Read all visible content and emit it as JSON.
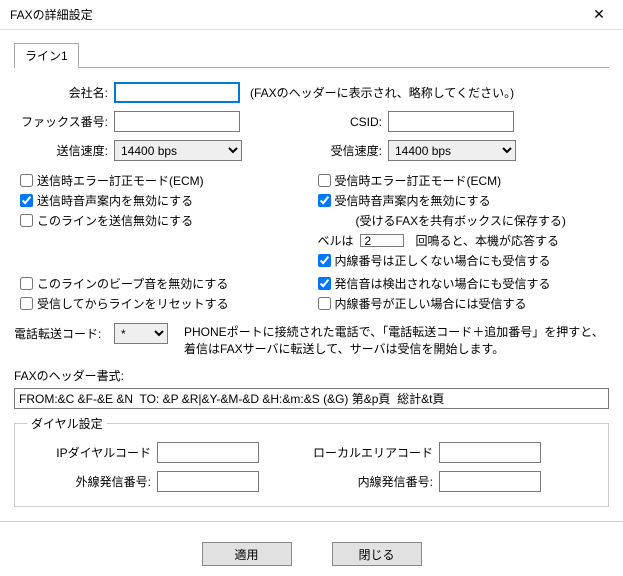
{
  "window": {
    "title": "FAXの詳細設定",
    "close_label": "✕"
  },
  "tabs": {
    "line1": "ライン1"
  },
  "labels": {
    "company": "会社名:",
    "company_hint": "(FAXのヘッダーに表示され、略称してください。)",
    "fax_number": "ファックス番号:",
    "csid": "CSID:",
    "send_speed": "送信速度:",
    "recv_speed": "受信速度:",
    "bells_prefix": "ベルは",
    "bells_suffix": "回鳴ると、本機が応答する",
    "transfer_code": "電話転送コード:",
    "transfer_note1": "PHONEポートに接続された電話で、「電話転送コード＋追加番号」を押すと、",
    "transfer_note2": "着信はFAXサーバに転送して、サーバは受信を開始します。",
    "header_format": "FAXのヘッダー書式:",
    "dial_group": "ダイヤル設定",
    "ip_dial": "IPダイヤルコード",
    "local_area": "ローカルエリアコード",
    "out_dial": "外線発信番号:",
    "in_dial": "内線発信番号:",
    "apply": "適用",
    "close_btn": "閉じる"
  },
  "speed_options": {
    "send": "14400 bps",
    "recv": "14400 bps"
  },
  "checkboxes": {
    "send_ecm": "送信時エラー訂正モード(ECM)",
    "send_audio_disable": "送信時音声案内を無効にする",
    "line_send_disable": "このラインを送信無効にする",
    "recv_ecm": "受信時エラー訂正モード(ECM)",
    "recv_audio_disable": "受信時音声案内を無効にする",
    "recv_save_shared": "(受けるFAXを共有ボックスに保存する)",
    "ext_wrong_recv": "内線番号は正しくない場合にも受信する",
    "line_beep_disable": "このラインのビープ音を無効にする",
    "tone_not_detected_recv": "発信音は検出されない場合にも受信する",
    "reset_after_recv": "受信してからラインをリセットする",
    "ext_correct_recv": "内線番号が正しい場合には受信する"
  },
  "values": {
    "company": "",
    "fax_number": "",
    "csid": "",
    "bells": "2",
    "transfer_code": "*",
    "header_format": "FROM:&C &F-&E &N  TO: &P &R|&Y-&M-&D &H:&m:&S (&G) 第&p頁  総計&t頁",
    "ip_dial": "",
    "local_area": "",
    "out_dial": "",
    "in_dial": ""
  }
}
